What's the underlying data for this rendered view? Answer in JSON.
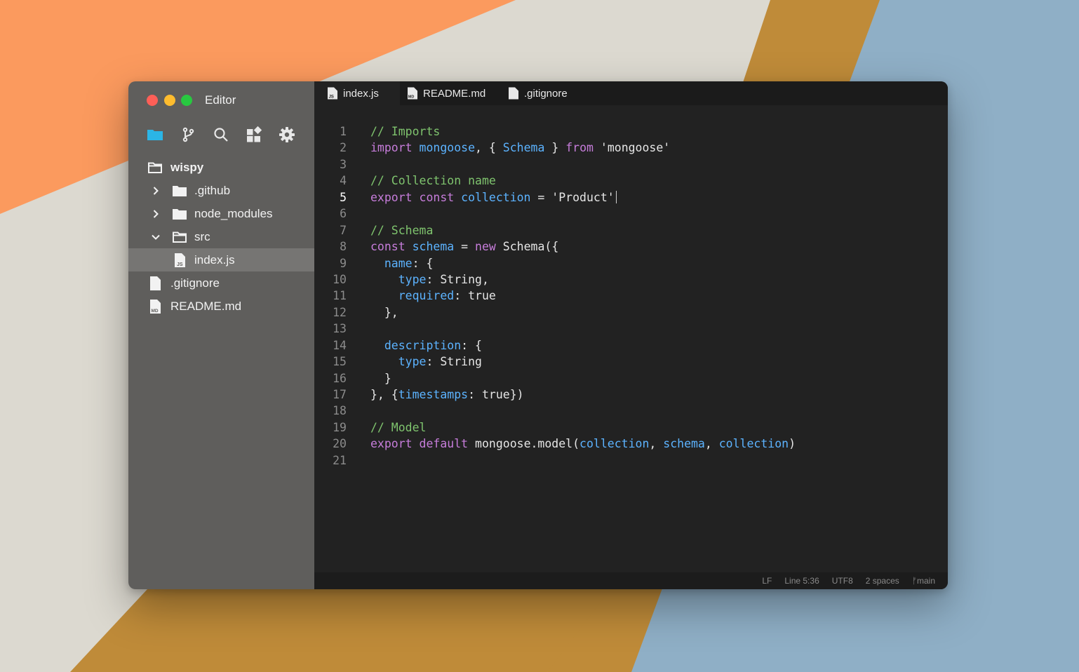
{
  "app": {
    "title": "Editor"
  },
  "colors": {
    "traffic_red": "#fe5f57",
    "traffic_yellow": "#febc2e",
    "traffic_green": "#28c840",
    "folder_accent": "#2bb5e6",
    "comment": "#7fc46e",
    "keyword": "#c77ddb",
    "identifier": "#5cb3ff"
  },
  "toolbar": {
    "items": [
      {
        "icon": "folder-icon",
        "active": true
      },
      {
        "icon": "git-branch-icon"
      },
      {
        "icon": "search-icon"
      },
      {
        "icon": "extensions-icon"
      },
      {
        "icon": "gear-icon"
      }
    ]
  },
  "tree": {
    "root": "wispy",
    "items": [
      {
        "label": ".github",
        "type": "folder",
        "expanded": false
      },
      {
        "label": "node_modules",
        "type": "folder",
        "expanded": false
      },
      {
        "label": "src",
        "type": "folder",
        "expanded": true
      },
      {
        "label": "index.js",
        "type": "file-js",
        "selected": true
      },
      {
        "label": ".gitignore",
        "type": "file"
      },
      {
        "label": "README.md",
        "type": "file-md"
      }
    ]
  },
  "tabs": [
    {
      "label": "index.js",
      "icon": "js-file-icon",
      "active": true
    },
    {
      "label": "README.md",
      "icon": "md-file-icon"
    },
    {
      "label": ".gitignore",
      "icon": "file-icon"
    }
  ],
  "editor": {
    "current_line": 5,
    "lines": [
      [
        {
          "t": "// Imports",
          "c": "c"
        }
      ],
      [
        {
          "t": "import",
          "c": "k"
        },
        {
          "t": " "
        },
        {
          "t": "mongoose",
          "c": "v"
        },
        {
          "t": ", { "
        },
        {
          "t": "Schema",
          "c": "v"
        },
        {
          "t": " } "
        },
        {
          "t": "from",
          "c": "k"
        },
        {
          "t": " 'mongoose'"
        }
      ],
      [],
      [
        {
          "t": "// Collection name",
          "c": "c"
        }
      ],
      [
        {
          "t": "export",
          "c": "k"
        },
        {
          "t": " "
        },
        {
          "t": "const",
          "c": "k"
        },
        {
          "t": " "
        },
        {
          "t": "collection",
          "c": "v"
        },
        {
          "t": " = 'Product'"
        }
      ],
      [],
      [
        {
          "t": "// Schema",
          "c": "c"
        }
      ],
      [
        {
          "t": "const",
          "c": "k"
        },
        {
          "t": " "
        },
        {
          "t": "schema",
          "c": "v"
        },
        {
          "t": " = "
        },
        {
          "t": "new",
          "c": "k"
        },
        {
          "t": " Schema({"
        }
      ],
      [
        {
          "t": "  "
        },
        {
          "t": "name",
          "c": "v"
        },
        {
          "t": ": {"
        }
      ],
      [
        {
          "t": "    "
        },
        {
          "t": "type",
          "c": "v"
        },
        {
          "t": ": String,"
        }
      ],
      [
        {
          "t": "    "
        },
        {
          "t": "required",
          "c": "v"
        },
        {
          "t": ": true"
        }
      ],
      [
        {
          "t": "  },"
        }
      ],
      [],
      [
        {
          "t": "  "
        },
        {
          "t": "description",
          "c": "v"
        },
        {
          "t": ": {"
        }
      ],
      [
        {
          "t": "    "
        },
        {
          "t": "type",
          "c": "v"
        },
        {
          "t": ": String"
        }
      ],
      [
        {
          "t": "  }"
        }
      ],
      [
        {
          "t": "}, {"
        },
        {
          "t": "timestamps",
          "c": "v"
        },
        {
          "t": ": true})"
        }
      ],
      [],
      [
        {
          "t": "// Model",
          "c": "c"
        }
      ],
      [
        {
          "t": "export",
          "c": "k"
        },
        {
          "t": " "
        },
        {
          "t": "default",
          "c": "k"
        },
        {
          "t": " mongoose.model("
        },
        {
          "t": "collection",
          "c": "v"
        },
        {
          "t": ", "
        },
        {
          "t": "schema",
          "c": "v"
        },
        {
          "t": ", "
        },
        {
          "t": "collection",
          "c": "v"
        },
        {
          "t": ")"
        }
      ],
      []
    ]
  },
  "status": {
    "eol": "LF",
    "position": "Line 5:36",
    "encoding": "UTF8",
    "indent": "2 spaces",
    "branch": "main",
    "branch_glyph": "ᚠ"
  }
}
